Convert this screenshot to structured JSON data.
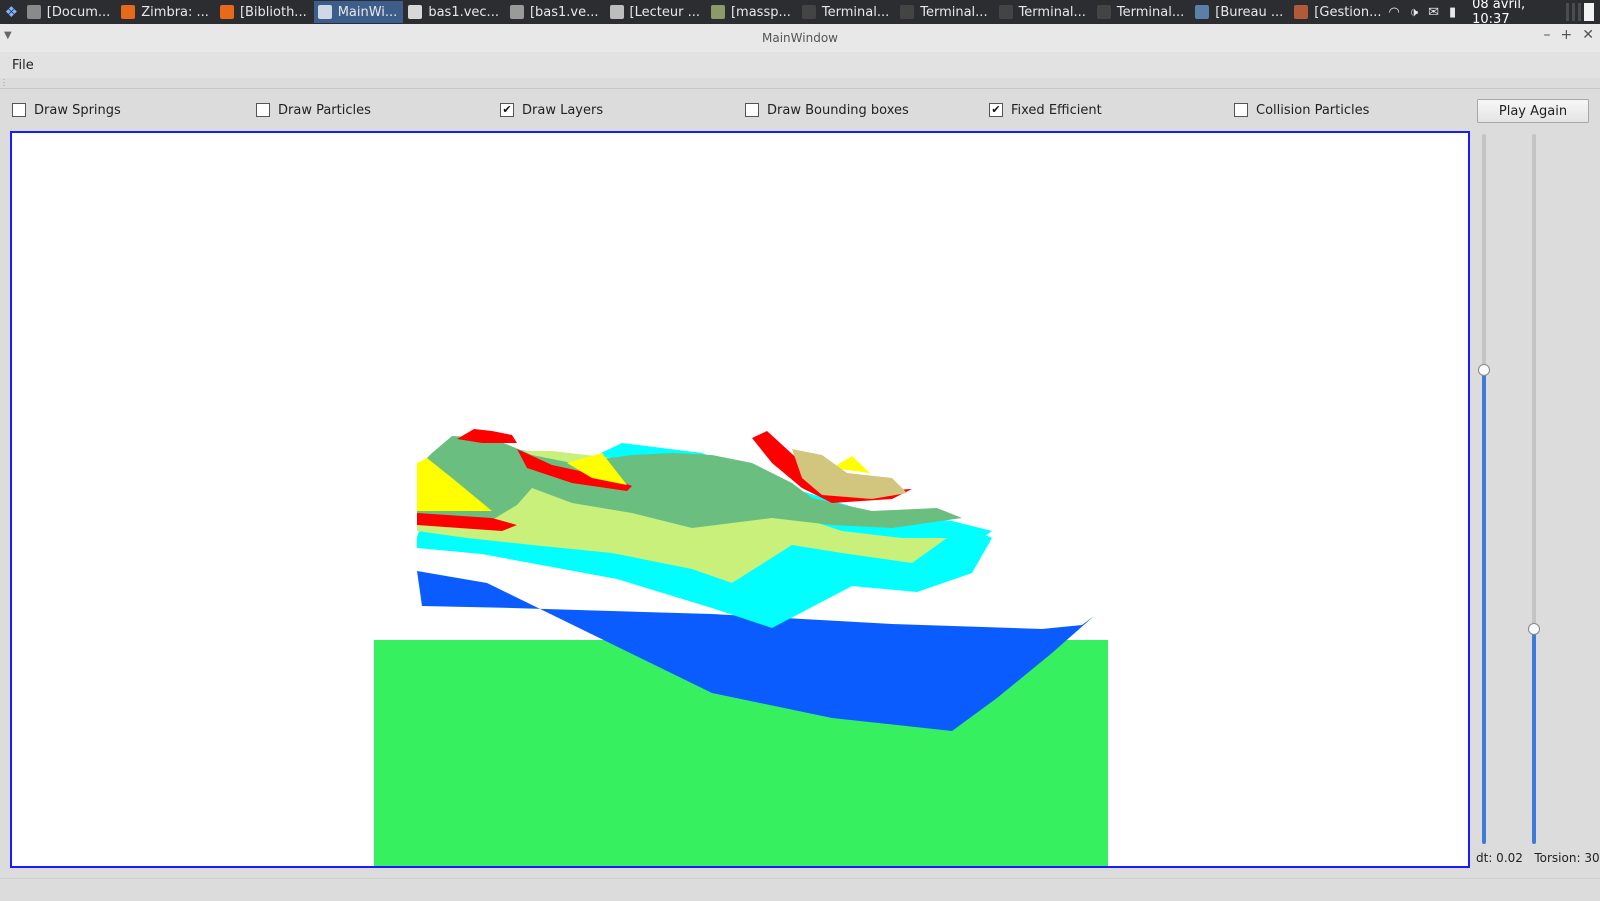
{
  "taskbar": {
    "tasks": [
      {
        "label": "[Docum...",
        "icon": "document-app-icon",
        "color": "#8a8a8a",
        "active": false
      },
      {
        "label": "Zimbra: ...",
        "icon": "firefox-icon",
        "color": "#e8681c",
        "active": false
      },
      {
        "label": "[Biblioth...",
        "icon": "firefox-icon",
        "color": "#e8681c",
        "active": false
      },
      {
        "label": "MainWi...",
        "icon": "window-icon",
        "color": "#cfd8e6",
        "active": true
      },
      {
        "label": "bas1.vec...",
        "icon": "text-editor-icon",
        "color": "#d8d8d8",
        "active": false
      },
      {
        "label": "[bas1.ve...",
        "icon": "file-manager-icon",
        "color": "#9a9a9a",
        "active": false
      },
      {
        "label": "[Lecteur ...",
        "icon": "media-player-icon",
        "color": "#bdbdbd",
        "active": false
      },
      {
        "label": "[massp...",
        "icon": "gimp-icon",
        "color": "#8c9a6a",
        "active": false
      },
      {
        "label": "Terminal...",
        "icon": "terminal-icon",
        "color": "#444",
        "active": false
      },
      {
        "label": "Terminal...",
        "icon": "terminal-icon",
        "color": "#444",
        "active": false
      },
      {
        "label": "Terminal...",
        "icon": "terminal-icon",
        "color": "#444",
        "active": false
      },
      {
        "label": "Terminal...",
        "icon": "terminal-icon",
        "color": "#444",
        "active": false
      },
      {
        "label": "[Bureau ...",
        "icon": "desktop-icon",
        "color": "#5b7fa8",
        "active": false
      },
      {
        "label": "[Gestion...",
        "icon": "task-manager-icon",
        "color": "#b05a3a",
        "active": false
      }
    ],
    "clock": "08 avril, 10:37"
  },
  "window": {
    "title": "MainWindow",
    "menu": [
      "File"
    ]
  },
  "controls": {
    "checkboxes": [
      {
        "label": "Draw Springs",
        "checked": false
      },
      {
        "label": "Draw Particles",
        "checked": false
      },
      {
        "label": "Draw Layers",
        "checked": true
      },
      {
        "label": "Draw Bounding boxes",
        "checked": false
      },
      {
        "label": "Fixed Efficient",
        "checked": true
      },
      {
        "label": "Collision Particles",
        "checked": false
      }
    ],
    "play_again_label": "Play Again",
    "check_mark": "✔"
  },
  "sliders": {
    "dt_slider_level": 0.67,
    "torsion_slider_level": 0.3
  },
  "status": {
    "dt": "dt: 0.02",
    "torsion": "Torsion: 30"
  },
  "colors": {
    "canvas_border": "#1a1aff",
    "ground": "#36f060",
    "layer_blue": "#0a5cff",
    "layer_cyan": "#00ffff",
    "layer_lightgreen": "#c8f07a",
    "layer_green": "#6abf80",
    "layer_red": "#ff0000",
    "layer_yellow": "#ffff00",
    "layer_khaki": "#d2c57e"
  }
}
